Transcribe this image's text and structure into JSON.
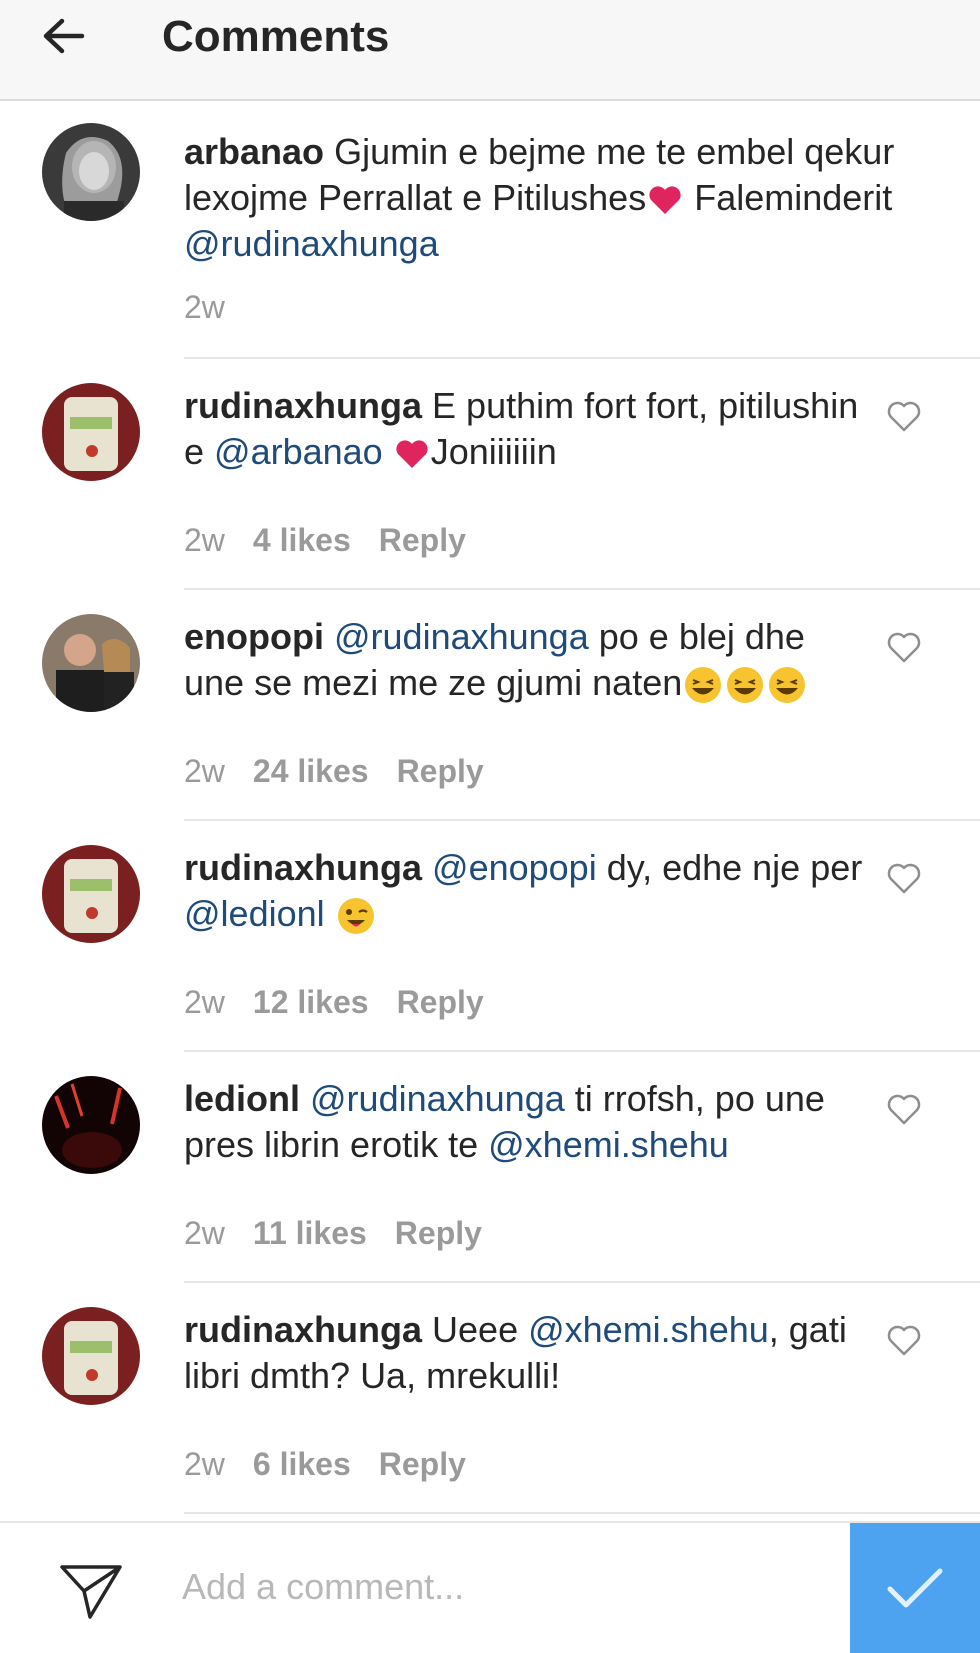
{
  "header": {
    "title": "Comments",
    "back_icon": "arrow-left-icon"
  },
  "colors": {
    "accent": "#4da3ef",
    "mention": "#1f4b7a",
    "heart": "#e0245e",
    "meta": "#9a9a9a"
  },
  "comments": [
    {
      "username": "arbanao",
      "parts": [
        "Gjumin e bejme me te embel qekur lexojme  Perrallat e Pitilushes",
        " Faleminderit "
      ],
      "mentions": [
        "@rudinaxhunga"
      ],
      "time": "2w"
    },
    {
      "username": "rudinaxhunga",
      "parts": [
        "E puthim fort fort, pitilushin e ",
        "Joniiiiiin"
      ],
      "mentions": [
        "@arbanao"
      ],
      "time": "2w",
      "likes": "4 likes",
      "reply": "Reply"
    },
    {
      "username": "enopopi",
      "parts": [
        "po e blej dhe une se mezi me ze gjumi naten"
      ],
      "mentions": [
        "@rudinaxhunga"
      ],
      "time": "2w",
      "likes": "24 likes",
      "reply": "Reply"
    },
    {
      "username": "rudinaxhunga",
      "parts": [
        "dy, edhe nje per "
      ],
      "mentions": [
        "@enopopi",
        "@ledionl"
      ],
      "time": "2w",
      "likes": "12 likes",
      "reply": "Reply"
    },
    {
      "username": "ledionl",
      "parts": [
        "ti rrofsh, po une pres librin erotik te "
      ],
      "mentions": [
        "@rudinaxhunga",
        "@xhemi.shehu"
      ],
      "time": "2w",
      "likes": "11 likes",
      "reply": "Reply"
    },
    {
      "username": "rudinaxhunga",
      "parts": [
        "Ueee ",
        ", gati libri dmth? Ua, mrekulli!"
      ],
      "mentions": [
        "@xhemi.shehu"
      ],
      "time": "2w",
      "likes": "6 likes",
      "reply": "Reply"
    }
  ],
  "footer": {
    "placeholder": "Add a comment...",
    "send_icon": "paper-plane-icon",
    "post_icon": "checkmark-icon"
  }
}
